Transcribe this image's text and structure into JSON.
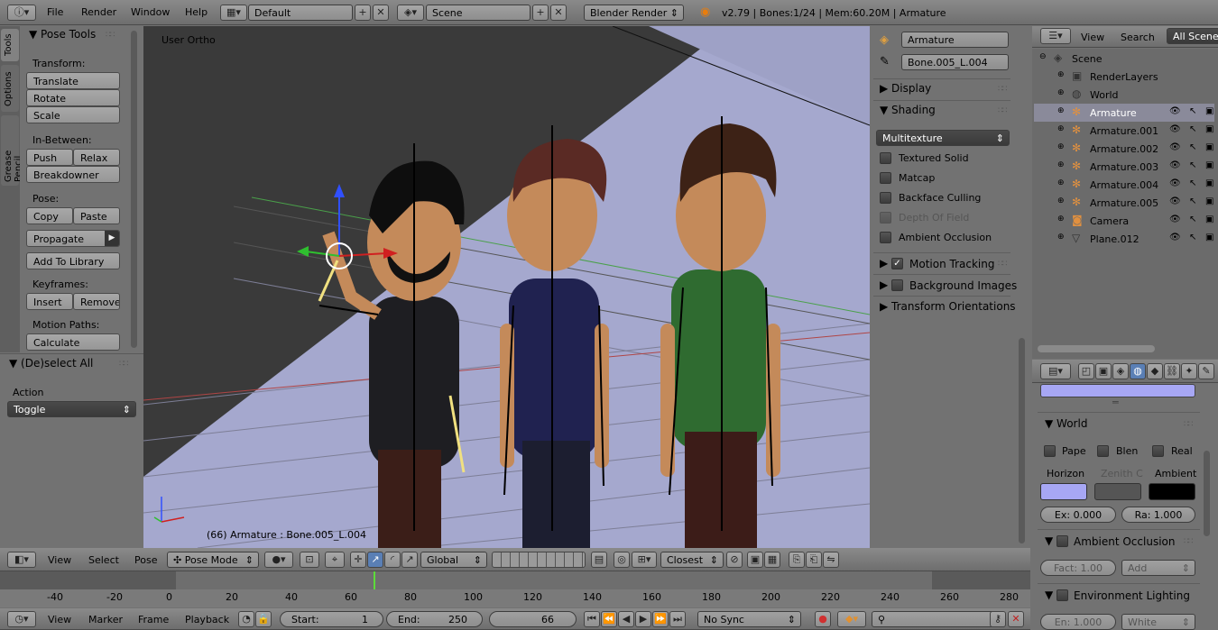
{
  "top_bar": {
    "menus": [
      "File",
      "Render",
      "Window",
      "Help"
    ],
    "layout": "Default",
    "scene": "Scene",
    "engine": "Blender Render",
    "stats": "v2.79 | Bones:1/24 | Mem:60.20M | Armature"
  },
  "tool_tabs": [
    "Tools",
    "Options",
    "Grease Pencil"
  ],
  "toolshelf": {
    "title": "Pose Tools",
    "transform_label": "Transform:",
    "translate": "Translate",
    "rotate": "Rotate",
    "scale": "Scale",
    "inbetween_label": "In-Between:",
    "push": "Push",
    "relax": "Relax",
    "breakdowner": "Breakdowner",
    "pose_label": "Pose:",
    "copy": "Copy",
    "paste": "Paste",
    "propagate": "Propagate",
    "add_to_library": "Add To Library",
    "keyframes_label": "Keyframes:",
    "insert": "Insert",
    "remove": "Remove",
    "motion_paths_label": "Motion Paths:",
    "calculate": "Calculate"
  },
  "operator_panel": {
    "title": "(De)select All",
    "action_label": "Action",
    "action_value": "Toggle"
  },
  "viewport": {
    "view_name": "User Ortho",
    "status": "(66) Armature : Bone.005_L.004"
  },
  "properties_n": {
    "object_name": "Armature",
    "bone_name": "Bone.005_L.004",
    "display": "Display",
    "shading": "Shading",
    "shading_mode": "Multitexture",
    "textured_solid": "Textured Solid",
    "matcap": "Matcap",
    "backface_culling": "Backface Culling",
    "depth_of_field": "Depth Of Field",
    "ambient_occlusion": "Ambient Occlusion",
    "motion_tracking": "Motion Tracking",
    "background_images": "Background Images",
    "transform_orientations": "Transform Orientations"
  },
  "outliner": {
    "menus": [
      "View",
      "Search"
    ],
    "filter": "All Scenes",
    "items": [
      {
        "name": "Scene",
        "level": 0,
        "icon": "scene-icon"
      },
      {
        "name": "RenderLayers",
        "level": 1,
        "icon": "renderlayers-icon"
      },
      {
        "name": "World",
        "level": 1,
        "icon": "world-icon"
      },
      {
        "name": "Armature",
        "level": 1,
        "icon": "armature-icon",
        "selected": true
      },
      {
        "name": "Armature.001",
        "level": 1,
        "icon": "armature-icon"
      },
      {
        "name": "Armature.002",
        "level": 1,
        "icon": "armature-icon"
      },
      {
        "name": "Armature.003",
        "level": 1,
        "icon": "armature-icon"
      },
      {
        "name": "Armature.004",
        "level": 1,
        "icon": "armature-icon"
      },
      {
        "name": "Armature.005",
        "level": 1,
        "icon": "armature-icon"
      },
      {
        "name": "Camera",
        "level": 1,
        "icon": "camera-icon"
      },
      {
        "name": "Plane.012",
        "level": 1,
        "icon": "mesh-icon"
      }
    ]
  },
  "world_props": {
    "world_title": "World",
    "paper": "Pape",
    "blend": "Blen",
    "real": "Real",
    "horizon": "Horizon",
    "zenith": "Zenith C",
    "ambient": "Ambient",
    "exposure": "Ex: 0.000",
    "range": "Ra: 1.000",
    "ao_title": "Ambient Occlusion",
    "factor": "Fact: 1.00",
    "add": "Add",
    "env_title": "Environment Lighting",
    "energy": "En: 1.000",
    "white": "White",
    "horizon_color": "#a7a7f4",
    "zenith_color": "#555555",
    "ambient_color": "#000000"
  },
  "view3d_header": {
    "menus": [
      "View",
      "Select",
      "Pose"
    ],
    "mode": "Pose Mode",
    "orientation": "Global",
    "snap": "Closest"
  },
  "timeline": {
    "ticks": [
      "-40",
      "-20",
      "0",
      "20",
      "40",
      "60",
      "80",
      "100",
      "120",
      "140",
      "160",
      "180",
      "200",
      "220",
      "240",
      "260",
      "280"
    ],
    "current_frame": 66
  },
  "timeline_header": {
    "menus": [
      "View",
      "Marker",
      "Frame",
      "Playback"
    ],
    "start_label": "Start:",
    "start_value": "1",
    "end_label": "End:",
    "end_value": "250",
    "current": "66",
    "sync": "No Sync"
  }
}
